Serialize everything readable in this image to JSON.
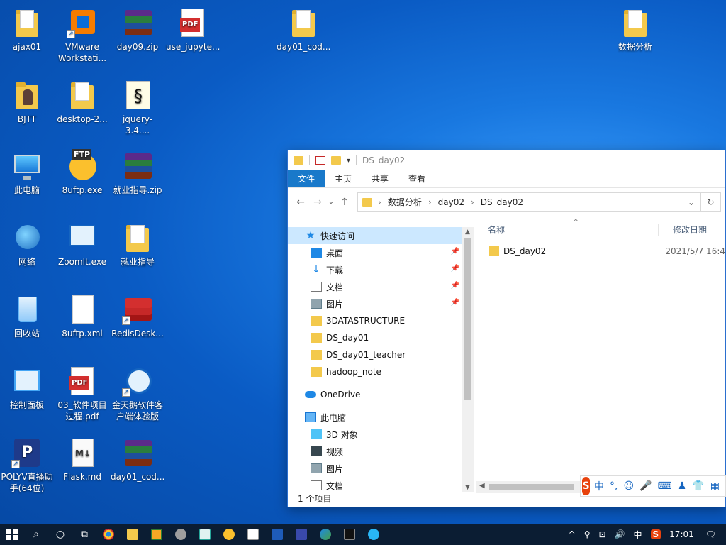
{
  "desktop": {
    "icons": [
      {
        "label": "ajax01"
      },
      {
        "label": "VMware\nWorkstati..."
      },
      {
        "label": "day09.zip"
      },
      {
        "label": "use_jupyte..."
      },
      {
        "label": "day01_cod..."
      },
      {
        "label": "数据分析"
      },
      {
        "label": "BJTT"
      },
      {
        "label": "desktop-2..."
      },
      {
        "label": "jquery-3.4...."
      },
      {
        "label": "此电脑"
      },
      {
        "label": "8uftp.exe"
      },
      {
        "label": "就业指导.zip"
      },
      {
        "label": "网络"
      },
      {
        "label": "ZoomIt.exe"
      },
      {
        "label": "就业指导"
      },
      {
        "label": "回收站"
      },
      {
        "label": "8uftp.xml"
      },
      {
        "label": "RedisDesk..."
      },
      {
        "label": "控制面板"
      },
      {
        "label": "03_软件项目\n过程.pdf"
      },
      {
        "label": "金天鹅软件客\n户端体验版"
      },
      {
        "label": "POLYV直播助\n手(64位)"
      },
      {
        "label": "Flask.md"
      },
      {
        "label": "day01_cod..."
      }
    ],
    "ftp_badge": "FTP",
    "pdf_badge": "PDF",
    "md_badge": "M↓",
    "polyv_badge": "P"
  },
  "explorer": {
    "title": "DS_day02",
    "ribbon_tabs": [
      "文件",
      "主页",
      "共享",
      "查看"
    ],
    "address": {
      "crumbs": [
        "数据分析",
        "day02",
        "DS_day02"
      ]
    },
    "nav": {
      "quick_access": "快速访问",
      "items": [
        "桌面",
        "下载",
        "文档",
        "图片",
        "3DATASTRUCTURE",
        "DS_day01",
        "DS_day01_teacher",
        "hadoop_note"
      ],
      "onedrive": "OneDrive",
      "this_pc": "此电脑",
      "pc_items": [
        "3D 对象",
        "视频",
        "图片",
        "文档"
      ]
    },
    "columns": {
      "name": "名称",
      "modified": "修改日期"
    },
    "files": [
      {
        "name": "DS_day02",
        "modified": "2021/5/7 16:4"
      }
    ],
    "status": "1 个项目"
  },
  "ime": {
    "logo": "S",
    "mode": "中",
    "punct": "°,"
  },
  "taskbar": {
    "tray_lang": "中",
    "clock": "17:01"
  },
  "colors": {
    "ribbon_active": "#1979ca",
    "nav_selected": "#cce8ff",
    "folder": "#f3c94c",
    "taskbar": "#0b1d33"
  }
}
